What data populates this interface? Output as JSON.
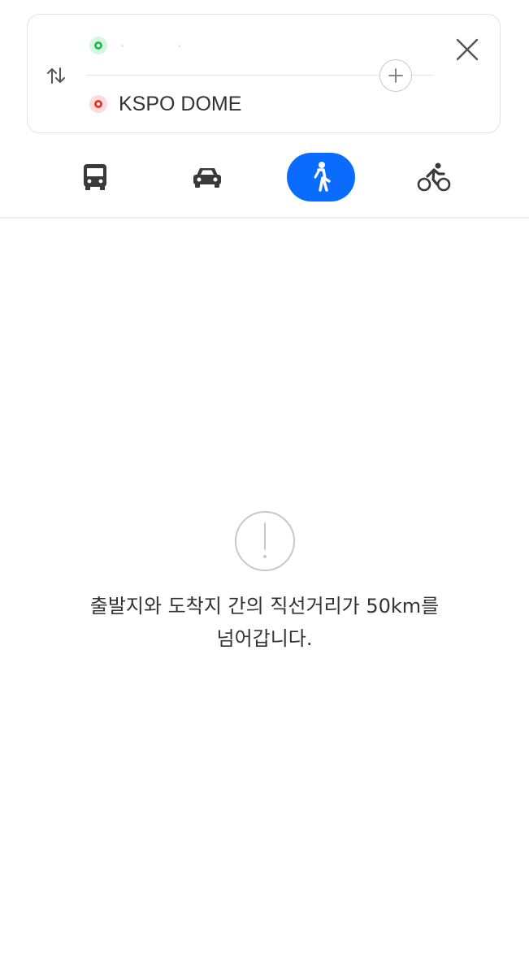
{
  "route": {
    "origin_text": "· ·",
    "destination_text": "KSPO DOME"
  },
  "icons": {
    "swap": "swap-vertical-icon",
    "add_waypoint": "plus-icon",
    "close": "close-icon",
    "warning": "exclamation-icon"
  },
  "modes": [
    {
      "name": "bus",
      "icon": "bus-icon",
      "active": false
    },
    {
      "name": "car",
      "icon": "car-icon",
      "active": false
    },
    {
      "name": "walk",
      "icon": "walk-icon",
      "active": true
    },
    {
      "name": "bike",
      "icon": "bicycle-icon",
      "active": false
    }
  ],
  "colors": {
    "accent": "#0a6cff",
    "origin": "#1fbf55",
    "destination": "#e8362c"
  },
  "notice": {
    "line1": "출발지와 도착지 간의 직선거리가 50km를",
    "line2": "넘어갑니다."
  }
}
